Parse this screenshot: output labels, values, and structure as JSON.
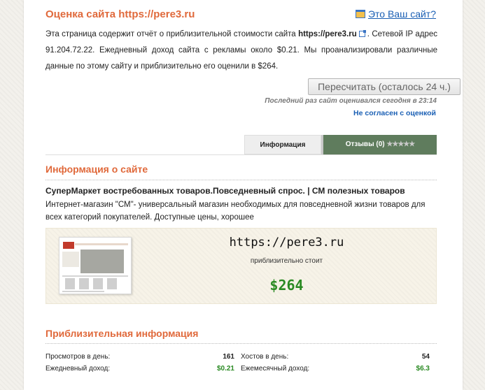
{
  "header": {
    "title": "Оценка сайта https://pere3.ru",
    "your_site_link": "Это Ваш сайт?"
  },
  "report": {
    "text_1": "Эта страница содержит отчёт о приблизительной стоимости сайта ",
    "domain": "https://pere3.ru",
    "text_2": ". Сетевой IP адрес 91.204.72.22. Ежедневный доход сайта с рекламы около $0.21. Мы проанализировали различные данные по этому сайту и приблизительно его оценили в $264."
  },
  "actions": {
    "recalc_button": "Пересчитать (осталось 24 ч.)",
    "last_calculated": "Последний раз сайт оценивался сегодня в 23:14",
    "disagree_link": "Не согласен с оценкой"
  },
  "tabs": [
    {
      "label": "Информация"
    },
    {
      "label": "Отзывы (0)",
      "stars": "★★★★★"
    }
  ],
  "site_info": {
    "heading": "Информация о сайте",
    "name": "СуперМаркет востребованных товаров.Повседневный спрос. | СМ полезных товаров",
    "description": "Интернет-магазин \"СМ\"- универсальный магазин необходимых для повседневной жизни товаров для всех категорий покупателей. Доступные цены, хорошее"
  },
  "estimate": {
    "domain": "https://pere3.ru",
    "approx_label": "приблизительно стоит",
    "price": "$264"
  },
  "approx_info": {
    "heading": "Приблизительная информация",
    "stats": [
      {
        "label": "Просмотров в день:",
        "value": "161"
      },
      {
        "label": "Хостов в день:",
        "value": "54"
      },
      {
        "label": "Ежедневный доход:",
        "value": "$0.21"
      },
      {
        "label": "Ежемесячный доход:",
        "value": "$6.3"
      }
    ]
  },
  "colors": {
    "accent": "#e0693b",
    "link": "#1a5fb4",
    "money": "#2a8a23",
    "tab_active": "#5f7c5d"
  }
}
